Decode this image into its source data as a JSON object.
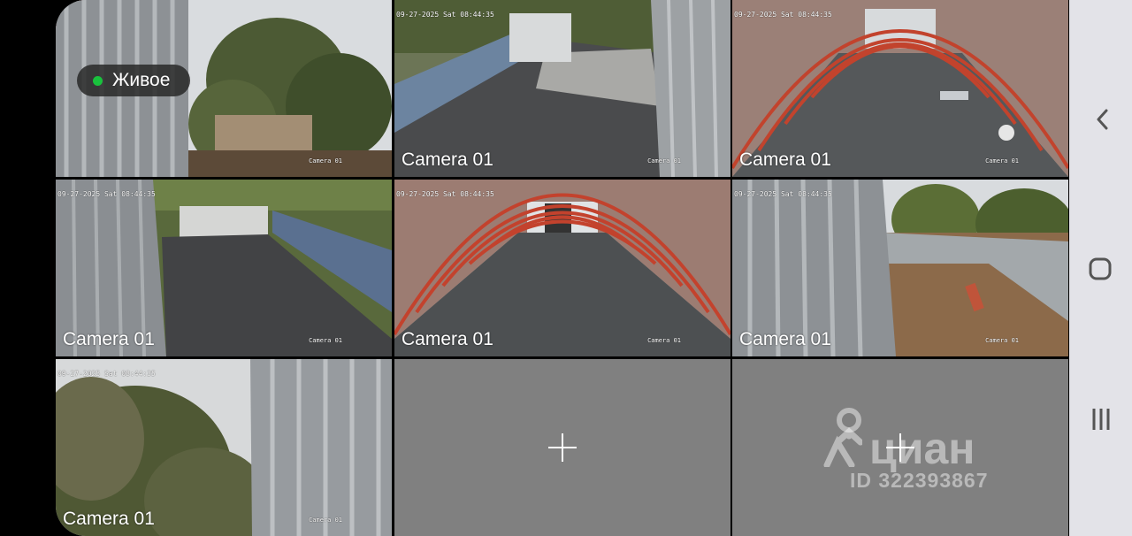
{
  "live_badge": {
    "label": "Живое",
    "status_color": "#19c23d"
  },
  "tiles": [
    {
      "label": "Camera 01",
      "timestamp": "",
      "osd": "Camera 01"
    },
    {
      "label": "Camera 01",
      "timestamp": "09-27-2025 Sat 08:44:35",
      "osd": "Camera 01"
    },
    {
      "label": "Camera 01",
      "timestamp": "09-27-2025 Sat 08:44:35",
      "osd": "Camera 01"
    },
    {
      "label": "Camera 01",
      "timestamp": "09-27-2025 Sat 08:44:35",
      "osd": "Camera 01"
    },
    {
      "label": "Camera 01",
      "timestamp": "09-27-2025 Sat 08:44:35",
      "osd": "Camera 01"
    },
    {
      "label": "Camera 01",
      "timestamp": "09-27-2025 Sat 08:44:35",
      "osd": "Camera 01"
    },
    {
      "label": "Camera 01",
      "timestamp": "09-27-2025 Sat 08:44:35",
      "osd": "Camera 01"
    }
  ],
  "empty_slots": [
    {
      "icon": "plus-icon"
    },
    {
      "icon": "plus-icon"
    }
  ],
  "watermark": {
    "brand": "циан",
    "id": "ID 322393867"
  },
  "nav": {
    "back": "back-icon",
    "home": "home-icon",
    "recents": "recents-icon"
  }
}
